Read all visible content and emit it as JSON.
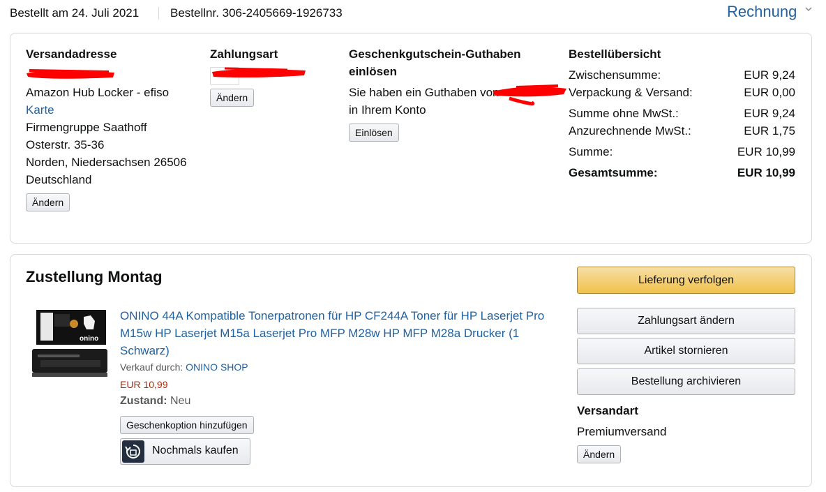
{
  "header": {
    "order_date": "Bestellt am 24. Juli 2021",
    "order_number": "Bestellnr. 306-2405669-1926733",
    "invoice_label": "Rechnung"
  },
  "shipping_address": {
    "heading": "Versandadresse",
    "line1": "Amazon Hub Locker - efiso",
    "map_link": "Karte",
    "line2": "Firmengruppe Saathoff",
    "line3": "Osterstr. 35-36",
    "line4": "Norden, Niedersachsen 26506",
    "line5": "Deutschland",
    "change_label": "Ändern"
  },
  "payment": {
    "heading": "Zahlungsart",
    "change_label": "Ändern"
  },
  "gift_card": {
    "heading_line1": "Geschenkgutschein-Guthaben",
    "heading_line2": "einlösen",
    "text_line1": "Sie haben ein Guthaben von",
    "text_line2": "in Ihrem Konto",
    "redeem_label": "Einlösen"
  },
  "summary": {
    "heading": "Bestellübersicht",
    "rows": [
      {
        "label": "Zwischensumme:",
        "value": "EUR 9,24"
      },
      {
        "label": "Verpackung & Versand:",
        "value": "EUR 0,00"
      },
      {
        "label": "Summe ohne MwSt.:",
        "value": "EUR 9,24"
      },
      {
        "label": "Anzurechnende MwSt.:",
        "value": "EUR 1,75"
      },
      {
        "label": "Summe:",
        "value": "EUR 10,99"
      },
      {
        "label": "Gesamtsumme:",
        "value": "EUR 10,99"
      }
    ]
  },
  "delivery": {
    "title": "Zustellung Montag",
    "product_title": "ONINO 44A Kompatible Tonerpatronen für HP CF244A Toner für HP Laserjet Pro M15w HP Laserjet M15a Laserjet Pro MFP M28w HP MFP M28a Drucker (1 Schwarz)",
    "sold_by_label": "Verkauf durch:",
    "seller": "ONINO SHOP",
    "price": "EUR 10,99",
    "condition_label": "Zustand:",
    "condition_value": "Neu",
    "gift_option_label": "Geschenkoption hinzufügen",
    "buy_again_label": "Nochmals kaufen",
    "brand_logo_text": "onino"
  },
  "actions": {
    "track": "Lieferung verfolgen",
    "change_payment": "Zahlungsart ändern",
    "cancel_items": "Artikel stornieren",
    "archive": "Bestellung archivieren"
  },
  "shipping_method": {
    "heading": "Versandart",
    "value": "Premiumversand",
    "change_label": "Ändern"
  },
  "colors": {
    "link": "#2162a1",
    "price": "#b12704",
    "primary_button": "#f0c14b",
    "redaction": "#ff0000"
  }
}
